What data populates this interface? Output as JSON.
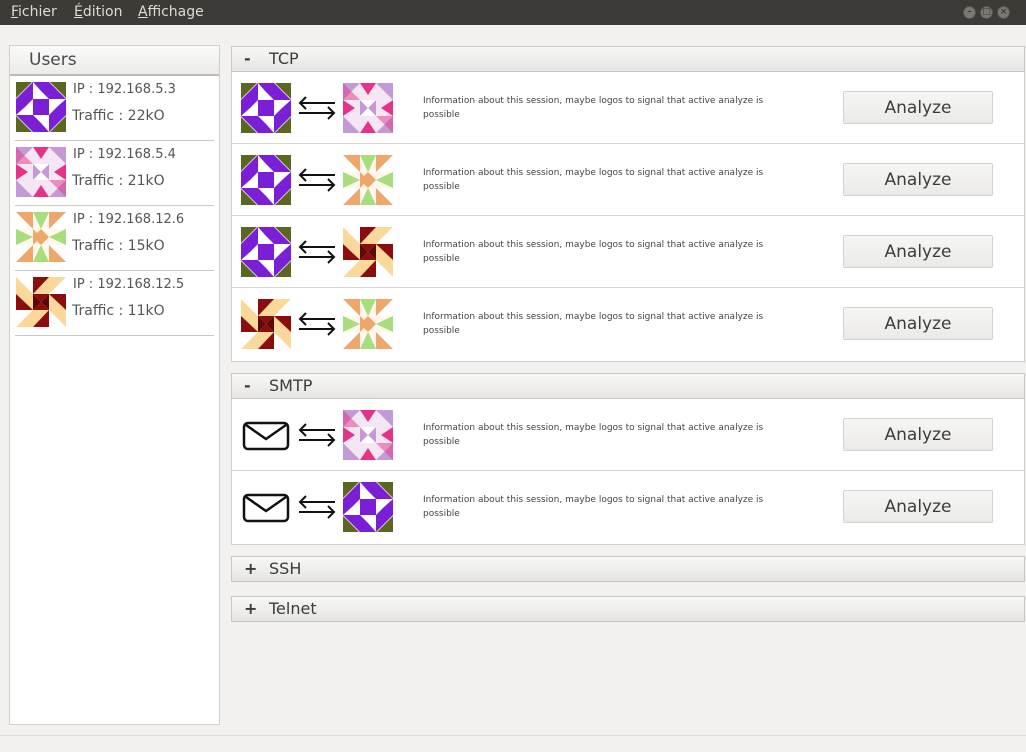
{
  "menu": {
    "items": [
      {
        "mnemonic": "F",
        "rest": "ichier"
      },
      {
        "mnemonic": "É",
        "rest": "dition"
      },
      {
        "mnemonic": "A",
        "rest": "ffichage"
      }
    ]
  },
  "users": {
    "title": "Users",
    "list": [
      {
        "ip": "IP : 192.168.5.3",
        "traffic": "Traffic : 22kO",
        "icon": "identicon-purple"
      },
      {
        "ip": "IP : 192.168.5.4",
        "traffic": "Traffic : 21kO",
        "icon": "identicon-pink"
      },
      {
        "ip": "IP : 192.168.12.6",
        "traffic": "Traffic : 15kO",
        "icon": "identicon-orange"
      },
      {
        "ip": "IP : 192.168.12.5",
        "traffic": "Traffic : 11kO",
        "icon": "identicon-darkred"
      }
    ]
  },
  "groups": {
    "tcp": {
      "sign": "-",
      "name": "TCP",
      "sessions": [
        {
          "info": "Information about this session, maybe logos to signal that active analyze is possible",
          "button": "Analyze",
          "from": "identicon-purple",
          "to": "identicon-pink"
        },
        {
          "info": "Information about this session, maybe logos to signal that active analyze is possible",
          "button": "Analyze",
          "from": "identicon-purple",
          "to": "identicon-orange"
        },
        {
          "info": "Information about this session, maybe logos to signal that active analyze is possible",
          "button": "Analyze",
          "from": "identicon-purple",
          "to": "identicon-darkred"
        },
        {
          "info": "Information about this session, maybe logos to signal that active analyze is possible",
          "button": "Analyze",
          "from": "identicon-darkred",
          "to": "identicon-orange"
        }
      ]
    },
    "smtp": {
      "sign": "-",
      "name": "SMTP",
      "sessions": [
        {
          "info": "Information about this session, maybe logos to signal that active analyze is possible",
          "button": "Analyze",
          "from": "envelope-icon",
          "to": "identicon-pink"
        },
        {
          "info": "Information about this session, maybe logos to signal that active analyze is possible",
          "button": "Analyze",
          "from": "envelope-icon",
          "to": "identicon-purple"
        }
      ]
    },
    "ssh": {
      "sign": "+",
      "name": "SSH"
    },
    "telnet": {
      "sign": "+",
      "name": "Telnet"
    }
  },
  "colors": {
    "purple": "#7a1fd6",
    "olive": "#5b6620",
    "pink": "#e6338a",
    "lilac": "#c49ad6",
    "orange": "#eda76b",
    "green": "#a7dd7b",
    "darkred": "#8b0d0d",
    "cream": "#fad89a"
  }
}
